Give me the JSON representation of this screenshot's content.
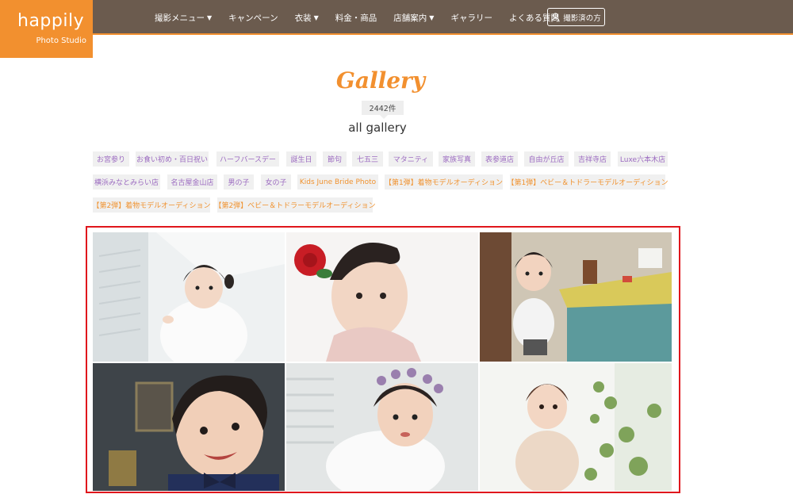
{
  "logo": {
    "brand": "happily",
    "sub": "Photo Studio"
  },
  "nav": {
    "items": [
      {
        "label": "撮影メニュー",
        "has_caret": true
      },
      {
        "label": "キャンペーン",
        "has_caret": false
      },
      {
        "label": "衣装",
        "has_caret": true
      },
      {
        "label": "料金・商品",
        "has_caret": false
      },
      {
        "label": "店舗案内",
        "has_caret": true
      },
      {
        "label": "ギャラリー",
        "has_caret": false
      },
      {
        "label": "よくある質問",
        "has_caret": false
      }
    ],
    "login_label": "撮影済の方"
  },
  "gallery": {
    "title": "Gallery",
    "count": "2442件",
    "subtitle": "all gallery"
  },
  "tags": [
    {
      "label": "お宮参り",
      "color": "purple"
    },
    {
      "label": "お食い初め・百日祝い",
      "color": "purple"
    },
    {
      "label": "ハーフバースデー",
      "color": "purple"
    },
    {
      "label": "誕生日",
      "color": "purple"
    },
    {
      "label": "節句",
      "color": "purple"
    },
    {
      "label": "七五三",
      "color": "purple"
    },
    {
      "label": "マタニティ",
      "color": "purple"
    },
    {
      "label": "家族写真",
      "color": "purple"
    },
    {
      "label": "表参道店",
      "color": "purple"
    },
    {
      "label": "自由が丘店",
      "color": "purple"
    },
    {
      "label": "吉祥寺店",
      "color": "purple"
    },
    {
      "label": "Luxe六本木店",
      "color": "purple"
    },
    {
      "label": "横浜みなとみらい店",
      "color": "purple"
    },
    {
      "label": "名古屋金山店",
      "color": "purple"
    },
    {
      "label": "男の子",
      "color": "purple"
    },
    {
      "label": "女の子",
      "color": "purple"
    },
    {
      "label": "Kids June Bride Photo",
      "color": "orange"
    },
    {
      "label": "【第1弾】着物モデルオーディション",
      "color": "orange"
    },
    {
      "label": "【第1弾】ベビー＆トドラーモデルオーディション",
      "color": "orange"
    },
    {
      "label": "【第2弾】着物モデルオーディション",
      "color": "orange"
    },
    {
      "label": "【第2弾】ベビー＆トドラーモデルオーディション",
      "color": "orange"
    }
  ],
  "colors": {
    "header_bg": "#6b5b4e",
    "accent": "#f2902f",
    "tag_purple": "#9b6ac0",
    "tag_orange": "#f0922f",
    "highlight_border": "#e0161c"
  }
}
